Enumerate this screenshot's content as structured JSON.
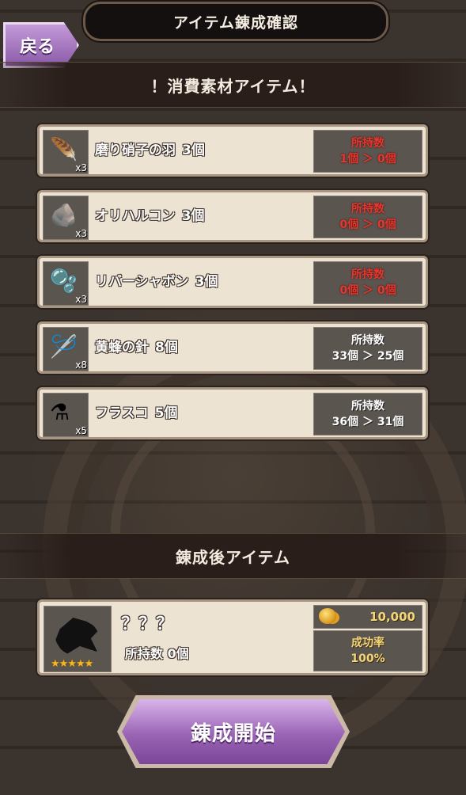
{
  "header": {
    "title": "アイテム錬成確認",
    "back_label": "戻る"
  },
  "materials_section": {
    "title": "！消費素材アイテム！"
  },
  "materials": [
    {
      "name": "磨り硝子の羽",
      "count": "3個",
      "qty_badge": "x3",
      "icon": "feather-icon",
      "owned_label": "所持数",
      "owned_change": "1個 ＞ 0個",
      "status": "short"
    },
    {
      "name": "オリハルコン",
      "count": "3個",
      "qty_badge": "x3",
      "icon": "ore-icon",
      "owned_label": "所持数",
      "owned_change": "0個 ＞ 0個",
      "status": "short"
    },
    {
      "name": "リバーシャボン",
      "count": "3個",
      "qty_badge": "x3",
      "icon": "bubble-flower-icon",
      "owned_label": "所持数",
      "owned_change": "0個 ＞ 0個",
      "status": "short"
    },
    {
      "name": "黄蜂の針",
      "count": "8個",
      "qty_badge": "x8",
      "icon": "needle-icon",
      "owned_label": "所持数",
      "owned_change": "33個 ＞ 25個",
      "status": "ok"
    },
    {
      "name": "フラスコ",
      "count": "5個",
      "qty_badge": "x5",
      "icon": "flask-icon",
      "owned_label": "所持数",
      "owned_change": "36個 ＞ 31個",
      "status": "ok"
    }
  ],
  "result_section": {
    "title": "錬成後アイテム"
  },
  "result": {
    "name": "？？？",
    "owned": "所持数 0個",
    "stars": "★★★★★",
    "cost": "10,000",
    "success_label": "成功率",
    "success_value": "100%"
  },
  "start_button": {
    "label": "錬成開始"
  },
  "colors": {
    "short": "#e23a30",
    "accent_purple": "#9a64b5",
    "gold": "#f3d57a"
  }
}
